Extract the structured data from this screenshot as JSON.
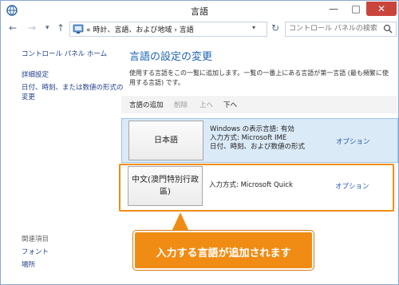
{
  "window": {
    "title": "言語",
    "minimize_glyph": "—",
    "maximize_glyph": "□",
    "close_glyph": "✕"
  },
  "nav": {
    "back_glyph": "←",
    "forward_glyph": "→",
    "dropdown_glyph": "▾",
    "up_glyph": "↑",
    "address_text": "« 時計、言語、および地域 › 言語",
    "address_dropdown_glyph": "▾",
    "refresh_glyph": "↻",
    "search_placeholder": "コントロール パネルの検索"
  },
  "sidebar": {
    "home_link": "コントロール パネル ホーム",
    "advanced_settings": "詳細設定",
    "datetime_format_line1": "日付、時刻、または数値の形式の",
    "datetime_format_line2": "変更",
    "related_heading": "関連項目",
    "related_items": [
      "フォント",
      "場所"
    ]
  },
  "main": {
    "title": "言語の設定の変更",
    "description": "使用する言語をこの一覧に追加します。一覧の一番上にある言語が第一言語 (最も頻繁に使用する言語) です。",
    "toolbar": {
      "add": "言語の追加",
      "remove": "削除",
      "up": "上へ",
      "down": "下へ"
    },
    "languages": [
      {
        "name": "日本語",
        "details": [
          "Windows の表示言語: 有効",
          "入力方式: Microsoft IME",
          "日付、時刻、および数値の形式"
        ],
        "option": "オプション",
        "selected": true
      },
      {
        "name": "中文(澳門特別行政區)",
        "details": [
          "入力方式: Microsoft Quick"
        ],
        "option": "オプション",
        "selected": false
      }
    ]
  },
  "annotation": {
    "text": "入力する言語が追加されます",
    "color": "#f08c14"
  },
  "colors": {
    "accent": "#1e64b4",
    "link": "#1f3e8c",
    "selected_row": "#dbeaf7",
    "close_button": "#c9453b"
  },
  "icons": {
    "app": "language-icon",
    "address": "control-panel-icon",
    "search": "search-icon"
  }
}
